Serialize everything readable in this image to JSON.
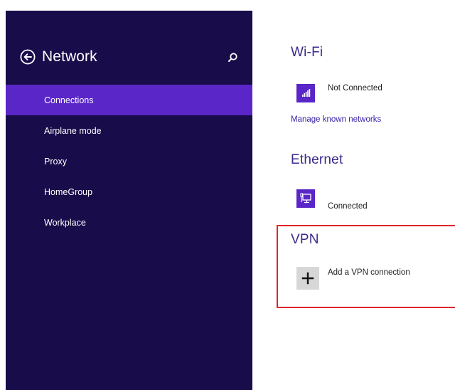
{
  "sidebar": {
    "title": "Network",
    "back_icon": "back-arrow-circle-icon",
    "search_icon": "search-icon",
    "items": [
      {
        "label": "Connections",
        "active": true
      },
      {
        "label": "Airplane mode",
        "active": false
      },
      {
        "label": "Proxy",
        "active": false
      },
      {
        "label": "HomeGroup",
        "active": false
      },
      {
        "label": "Workplace",
        "active": false
      }
    ]
  },
  "wifi": {
    "title": "Wi-Fi",
    "icon": "wifi-signal-icon",
    "status": "Not Connected",
    "manage_link": "Manage known networks"
  },
  "ethernet": {
    "title": "Ethernet",
    "icon": "ethernet-icon",
    "status": "Connected"
  },
  "vpn": {
    "title": "VPN",
    "add_icon": "plus-icon",
    "add_label": "Add a VPN connection"
  },
  "colors": {
    "sidebar_bg": "#180c4a",
    "accent": "#5a26c8",
    "heading": "#3a2a8c",
    "highlight": "#e0232b"
  }
}
